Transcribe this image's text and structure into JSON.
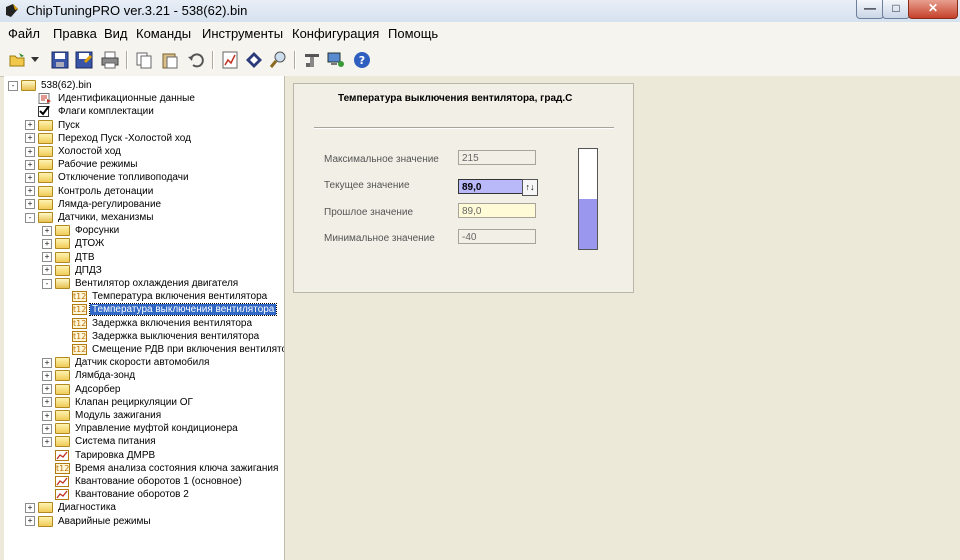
{
  "window": {
    "title": "ChipTuningPRO ver.3.21 - 538(62).bin"
  },
  "menu": [
    "Файл",
    "Правка",
    "Вид",
    "Команды",
    "Инструменты",
    "Конфигурация",
    "Помощь"
  ],
  "toolbar_icons": [
    "open-icon",
    "dropdown-arrow-icon",
    "save-icon",
    "save-as-icon",
    "print-icon",
    "copy-icon",
    "paste-icon",
    "undo-icon",
    "chart-icon",
    "diamond-icon",
    "search-icon",
    "tools-icon",
    "connect-icon",
    "help-icon"
  ],
  "tree": [
    {
      "label": "538(62).bin",
      "icon": "root-folder",
      "exp": "-",
      "level": 0
    },
    {
      "label": "Идентификационные данные",
      "icon": "id-doc",
      "exp": "",
      "level": 1
    },
    {
      "label": "Флаги комплектации",
      "icon": "checkbox",
      "exp": "",
      "level": 1
    },
    {
      "label": "Пуск",
      "icon": "folder",
      "exp": "+",
      "level": 1
    },
    {
      "label": "Переход Пуск -Холостой ход",
      "icon": "folder",
      "exp": "+",
      "level": 1
    },
    {
      "label": "Холостой ход",
      "icon": "folder",
      "exp": "+",
      "level": 1
    },
    {
      "label": "Рабочие режимы",
      "icon": "folder",
      "exp": "+",
      "level": 1
    },
    {
      "label": "Отключение топливоподачи",
      "icon": "folder",
      "exp": "+",
      "level": 1
    },
    {
      "label": "Контроль детонации",
      "icon": "folder",
      "exp": "+",
      "level": 1
    },
    {
      "label": "Лямда-регулирование",
      "icon": "folder",
      "exp": "+",
      "level": 1
    },
    {
      "label": "Датчики, механизмы",
      "icon": "folder-open",
      "exp": "-",
      "level": 1
    },
    {
      "label": "Форсунки",
      "icon": "folder",
      "exp": "+",
      "level": 2
    },
    {
      "label": "ДТОЖ",
      "icon": "folder",
      "exp": "+",
      "level": 2
    },
    {
      "label": "ДТВ",
      "icon": "folder",
      "exp": "+",
      "level": 2
    },
    {
      "label": "ДПДЗ",
      "icon": "folder",
      "exp": "+",
      "level": 2
    },
    {
      "label": "Вентилятор охлаждения двигателя",
      "icon": "folder-open",
      "exp": "-",
      "level": 2
    },
    {
      "label": "Температура включения вентилятора",
      "icon": "t12",
      "exp": "",
      "level": 3
    },
    {
      "label": "Температура выключения вентилятора",
      "icon": "t12",
      "exp": "",
      "level": 3,
      "selected": true
    },
    {
      "label": "Задержка включения вентилятора",
      "icon": "t12",
      "exp": "",
      "level": 3
    },
    {
      "label": "Задержка выключения вентилятора",
      "icon": "t12",
      "exp": "",
      "level": 3
    },
    {
      "label": "Смещение РДВ при включения вентилятора",
      "icon": "t12",
      "exp": "",
      "level": 3
    },
    {
      "label": "Датчик скорости автомобиля",
      "icon": "folder",
      "exp": "+",
      "level": 2
    },
    {
      "label": "Лямбда-зонд",
      "icon": "folder",
      "exp": "+",
      "level": 2
    },
    {
      "label": "Адсорбер",
      "icon": "folder",
      "exp": "+",
      "level": 2
    },
    {
      "label": "Клапан рециркуляции ОГ",
      "icon": "folder",
      "exp": "+",
      "level": 2
    },
    {
      "label": "Модуль зажигания",
      "icon": "folder",
      "exp": "+",
      "level": 2
    },
    {
      "label": "Управление муфтой кондиционера",
      "icon": "folder",
      "exp": "+",
      "level": 2
    },
    {
      "label": "Система питания",
      "icon": "folder",
      "exp": "+",
      "level": 2
    },
    {
      "label": "Тарировка ДМРВ",
      "icon": "graph",
      "exp": "",
      "level": 2
    },
    {
      "label": "Время анализа состояния ключа зажигания",
      "icon": "t12",
      "exp": "",
      "level": 2
    },
    {
      "label": "Квантование оборотов 1 (основное)",
      "icon": "graph",
      "exp": "",
      "level": 2
    },
    {
      "label": "Квантование оборотов 2",
      "icon": "graph",
      "exp": "",
      "level": 2
    },
    {
      "label": "Диагностика",
      "icon": "folder",
      "exp": "+",
      "level": 1
    },
    {
      "label": "Аварийные режимы",
      "icon": "folder",
      "exp": "+",
      "level": 1
    }
  ],
  "param_panel": {
    "title": "Температура выключения вентилятора, град.С",
    "labels": {
      "max": "Максимальное значение",
      "current": "Текущее значение",
      "past": "Прошлое значение",
      "min": "Минимальное значение"
    },
    "values": {
      "max": "215",
      "current": "89,0",
      "past": "89,0",
      "min": "-40"
    },
    "gauge_fraction": 0.5
  },
  "colors": {
    "selection": "#3168c6",
    "current_field": "#b9b8f8",
    "gauge_fill": "#9a98ee",
    "past_field": "#fffbd6"
  }
}
